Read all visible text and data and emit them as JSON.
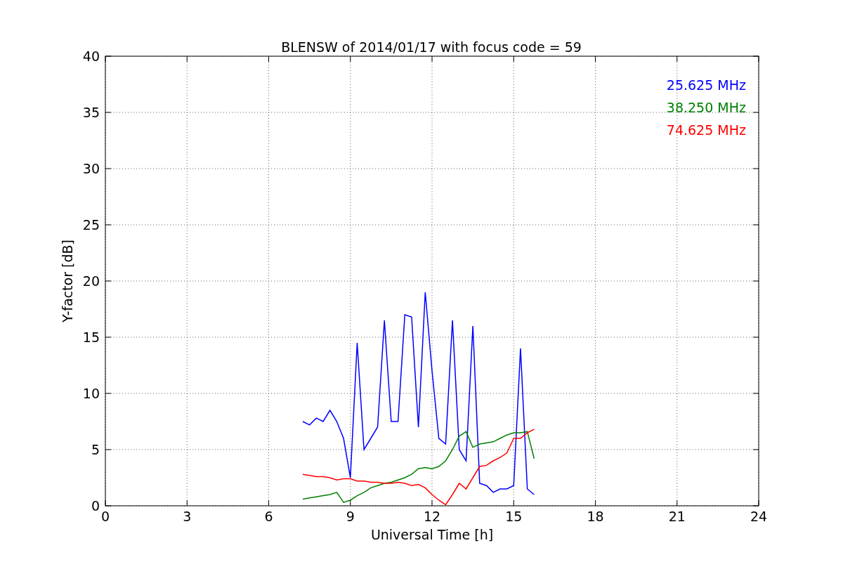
{
  "chart_data": {
    "type": "line",
    "title": "BLENSW of 2014/01/17 with focus code = 59",
    "xlabel": "Universal Time [h]",
    "ylabel": "Y-factor [dB]",
    "x": [
      7.25,
      7.5,
      7.75,
      8.0,
      8.25,
      8.5,
      8.75,
      9.0,
      9.25,
      9.5,
      9.75,
      10.0,
      10.25,
      10.5,
      10.75,
      11.0,
      11.25,
      11.5,
      11.75,
      12.0,
      12.25,
      12.5,
      12.75,
      13.0,
      13.25,
      13.5,
      13.75,
      14.0,
      14.25,
      14.5,
      14.75,
      15.0,
      15.25,
      15.5,
      15.75
    ],
    "series": [
      {
        "name": "25.625 MHz",
        "color": "#0000ff",
        "values": [
          7.5,
          7.2,
          7.8,
          7.5,
          8.5,
          7.5,
          6,
          2.5,
          14.5,
          5,
          6,
          7,
          16.5,
          7.5,
          7.5,
          17,
          16.8,
          7,
          19,
          12,
          6,
          5.5,
          16.5,
          5,
          4,
          16,
          2,
          1.8,
          1.2,
          1.5,
          1.5,
          1.8,
          14,
          1.5,
          1
        ]
      },
      {
        "name": "38.250 MHz",
        "color": "#008000",
        "values": [
          0.6,
          0.7,
          0.8,
          0.9,
          1,
          1.2,
          0.3,
          0.5,
          0.9,
          1.2,
          1.6,
          1.8,
          2,
          2.1,
          2.3,
          2.5,
          2.8,
          3.3,
          3.4,
          3.3,
          3.5,
          4,
          5,
          6.2,
          6.6,
          5.2,
          5.5,
          5.6,
          5.7,
          6,
          6.3,
          6.5,
          6.5,
          6.6,
          4.2
        ]
      },
      {
        "name": "74.625 MHz",
        "color": "#ff0000",
        "values": [
          2.8,
          2.7,
          2.6,
          2.6,
          2.5,
          2.3,
          2.4,
          2.4,
          2.2,
          2.2,
          2.1,
          2.1,
          2,
          2,
          2.1,
          2,
          1.8,
          1.9,
          1.6,
          1,
          0.5,
          0.1,
          1,
          2,
          1.5,
          2.5,
          3.5,
          3.6,
          4,
          4.3,
          4.7,
          6,
          6,
          6.5,
          6.8
        ]
      }
    ],
    "xlim": [
      0,
      24
    ],
    "ylim": [
      0,
      40
    ],
    "xticks": [
      0,
      3,
      6,
      9,
      12,
      15,
      18,
      21,
      24
    ],
    "yticks": [
      0,
      5,
      10,
      15,
      20,
      25,
      30,
      35,
      40
    ],
    "grid": true
  }
}
